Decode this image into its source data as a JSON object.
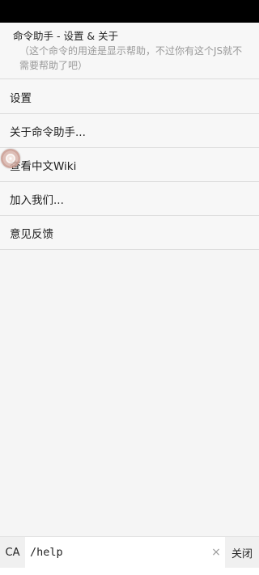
{
  "header": {
    "title": "命令助手 - 设置 & 关于",
    "description": "（这个命令的用途是显示帮助，不过你有这个JS就不需要帮助了吧）"
  },
  "menu": {
    "items": [
      {
        "label": "设置"
      },
      {
        "label": "关于命令助手..."
      },
      {
        "label": "查看中文Wiki"
      },
      {
        "label": "加入我们..."
      },
      {
        "label": "意见反馈"
      }
    ]
  },
  "bottom_bar": {
    "prefix_label": "CA",
    "command_value": "/help",
    "clear_icon": "×",
    "close_label": "关闭"
  },
  "colors": {
    "status_bar": "#000000",
    "background": "#f5f5f5",
    "divider": "#dedede",
    "secondary_text": "#9a9a9a"
  },
  "icons": {
    "floating_ball": "floating-assistant-icon",
    "clear": "clear-icon"
  }
}
